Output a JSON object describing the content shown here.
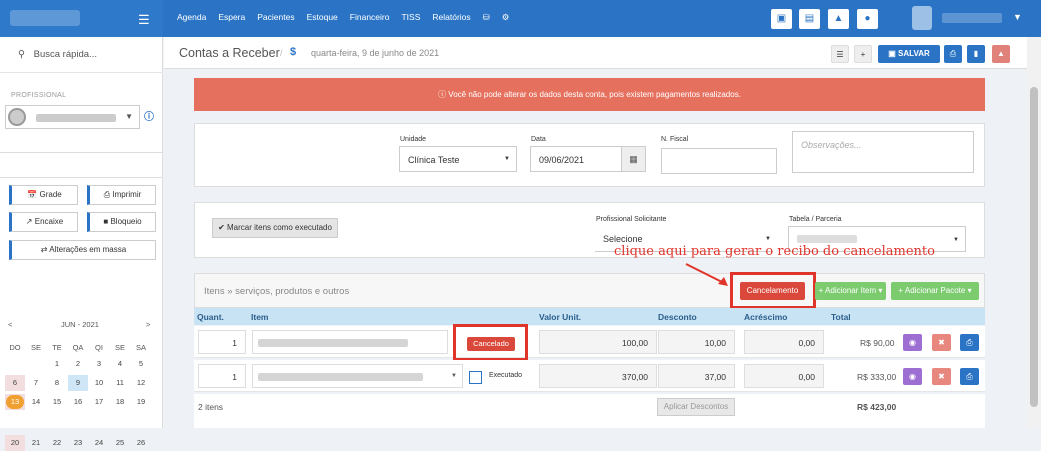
{
  "topbar": {
    "nav": [
      "Agenda",
      "Espera",
      "Pacientes",
      "Estoque",
      "Financeiro",
      "TISS",
      "Relatórios"
    ],
    "icons": [
      "database-icon",
      "gear-icon"
    ],
    "right_icons": [
      "inbox-icon",
      "card-icon",
      "bell-icon",
      "chat-icon"
    ]
  },
  "sidebar": {
    "search_placeholder": "Busca rápida...",
    "prof_label": "PROFISSIONAL",
    "buttons": {
      "grade": "Grade",
      "imprimir": "Imprimir",
      "encaixe": "Encaixe",
      "bloqueio": "Bloqueio",
      "alteracoes": "Alterações em massa"
    },
    "calendar": {
      "month": "JUN - 2021",
      "prev": "<",
      "next": ">",
      "dows": [
        "DO",
        "SE",
        "TE",
        "QA",
        "QI",
        "SE",
        "SA"
      ],
      "weeks": [
        [
          "",
          "",
          "1",
          "2",
          "3",
          "4",
          "5"
        ],
        [
          "6",
          "7",
          "8",
          "9",
          "10",
          "11",
          "12"
        ],
        [
          "13",
          "14",
          "15",
          "16",
          "17",
          "18",
          "19"
        ],
        [
          "20",
          "21",
          "22",
          "23",
          "24",
          "25",
          "26"
        ]
      ]
    }
  },
  "header": {
    "title": "Contas a Receber",
    "separator": "/",
    "crumb_icon": "$",
    "date": "quarta-feira, 9 de junho de 2021",
    "save_label": "SALVAR"
  },
  "alert": {
    "text": "Você não pode alterar os dados desta conta, pois existem pagamentos realizados."
  },
  "form": {
    "unidade_label": "Unidade",
    "unidade_value": "Clínica Teste",
    "data_label": "Data",
    "data_value": "09/06/2021",
    "nfiscal_label": "N. Fiscal",
    "nfiscal_value": "",
    "obs_placeholder": "Observações...",
    "mark_executed": "Marcar itens como executado",
    "prof_sol_label": "Profissional Solicitante",
    "prof_sol_value": "Selecione",
    "tabela_label": "Tabela / Parceria"
  },
  "items": {
    "title": "Itens » serviços, produtos e outros",
    "cancel_label": "Cancelamento",
    "add_item": "+ Adicionar Item",
    "add_pacote": "+ Adicionar Pacote",
    "columns": [
      "Quant.",
      "Item",
      "Valor Unit.",
      "Desconto",
      "Acréscimo",
      "Total"
    ],
    "rows": [
      {
        "qty": "1",
        "status": "Cancelado",
        "valor": "100,00",
        "desconto": "10,00",
        "acrescimo": "0,00",
        "total": "R$ 90,00"
      },
      {
        "qty": "1",
        "status": "Executado",
        "valor": "370,00",
        "desconto": "37,00",
        "acrescimo": "0,00",
        "total": "R$ 333,00"
      }
    ],
    "count": "2 itens",
    "apply_discounts": "Aplicar Descontos",
    "grand_total": "R$ 423,00"
  },
  "annotation": {
    "text": "clique aqui para gerar o recibo do cancelamento",
    "color": "#e0342a"
  },
  "colors": {
    "brand": "#2b74c5",
    "danger": "#d9483a",
    "success": "#7ccb6f",
    "alert": "#e5705e"
  }
}
